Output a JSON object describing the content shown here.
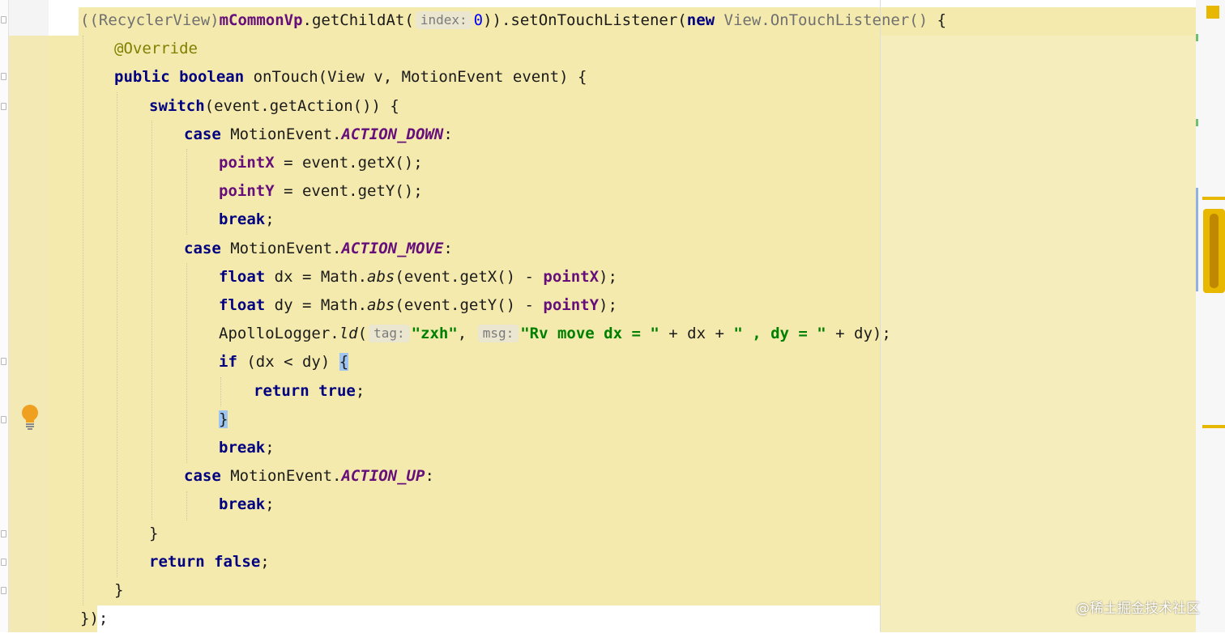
{
  "editor": {
    "colors": {
      "line_highlight": "#f4eaad",
      "keyword": "#000080",
      "field": "#660e7a",
      "string": "#008000",
      "annotation": "#808000",
      "number": "#0000ff",
      "brace_match": "#9fc6f2"
    },
    "lines": [
      {
        "tokens": [
          {
            "t": "((RecyclerView)",
            "c": "gr"
          },
          {
            "t": "mCommonVp",
            "c": "fld"
          },
          {
            "t": ".getChildAt(",
            "c": ""
          },
          {
            "t": "index:",
            "c": "hint"
          },
          {
            "t": "0",
            "c": "num"
          },
          {
            "t": ")).setOnTouchListener(",
            "c": ""
          },
          {
            "t": "new",
            "c": "kw"
          },
          {
            "t": " View.OnTouchListener()",
            "c": "gr"
          },
          {
            "t": " {",
            "c": ""
          }
        ]
      },
      {
        "tokens": [
          {
            "t": "@Override",
            "c": "ann"
          }
        ]
      },
      {
        "tokens": [
          {
            "t": "public boolean",
            "c": "kw"
          },
          {
            "t": " onTouch(View v, MotionEvent event) {",
            "c": ""
          }
        ]
      },
      {
        "tokens": [
          {
            "t": "switch",
            "c": "kw"
          },
          {
            "t": "(event.getAction()) {",
            "c": ""
          }
        ]
      },
      {
        "tokens": [
          {
            "t": "case",
            "c": "kw"
          },
          {
            "t": " MotionEvent.",
            "c": ""
          },
          {
            "t": "ACTION_DOWN",
            "c": "cst"
          },
          {
            "t": ":",
            "c": ""
          }
        ]
      },
      {
        "tokens": [
          {
            "t": "pointX",
            "c": "fld"
          },
          {
            "t": " = event.getX();",
            "c": ""
          }
        ]
      },
      {
        "tokens": [
          {
            "t": "pointY",
            "c": "fld"
          },
          {
            "t": " = event.getY();",
            "c": ""
          }
        ]
      },
      {
        "tokens": [
          {
            "t": "break",
            "c": "kw"
          },
          {
            "t": ";",
            "c": ""
          }
        ]
      },
      {
        "tokens": [
          {
            "t": "case",
            "c": "kw"
          },
          {
            "t": " MotionEvent.",
            "c": ""
          },
          {
            "t": "ACTION_MOVE",
            "c": "cst"
          },
          {
            "t": ":",
            "c": ""
          }
        ]
      },
      {
        "tokens": [
          {
            "t": "float",
            "c": "kw"
          },
          {
            "t": " dx = Math.",
            "c": ""
          },
          {
            "t": "abs",
            "c": "it"
          },
          {
            "t": "(event.getX() - ",
            "c": ""
          },
          {
            "t": "pointX",
            "c": "fld"
          },
          {
            "t": ");",
            "c": ""
          }
        ]
      },
      {
        "tokens": [
          {
            "t": "float",
            "c": "kw"
          },
          {
            "t": " dy = Math.",
            "c": ""
          },
          {
            "t": "abs",
            "c": "it"
          },
          {
            "t": "(event.getY() - ",
            "c": ""
          },
          {
            "t": "pointY",
            "c": "fld"
          },
          {
            "t": ");",
            "c": ""
          }
        ]
      },
      {
        "tokens": [
          {
            "t": "ApolloLogger.",
            "c": ""
          },
          {
            "t": "ld",
            "c": "it"
          },
          {
            "t": "(",
            "c": ""
          },
          {
            "t": "tag:",
            "c": "hint"
          },
          {
            "t": "\"zxh\"",
            "c": "str"
          },
          {
            "t": ", ",
            "c": ""
          },
          {
            "t": "msg:",
            "c": "hint"
          },
          {
            "t": "\"Rv move dx = \"",
            "c": "str"
          },
          {
            "t": " + dx + ",
            "c": ""
          },
          {
            "t": "\" , dy = \"",
            "c": "str"
          },
          {
            "t": " + dy);",
            "c": ""
          }
        ]
      },
      {
        "tokens": [
          {
            "t": "if",
            "c": "kw"
          },
          {
            "t": " (dx < dy) ",
            "c": ""
          },
          {
            "t": "{",
            "c": "brace-hl"
          }
        ]
      },
      {
        "tokens": [
          {
            "t": "return true",
            "c": "kw"
          },
          {
            "t": ";",
            "c": ""
          }
        ]
      },
      {
        "tokens": [
          {
            "t": "}",
            "c": "brace-hl"
          }
        ]
      },
      {
        "tokens": [
          {
            "t": "break",
            "c": "kw"
          },
          {
            "t": ";",
            "c": ""
          }
        ]
      },
      {
        "tokens": [
          {
            "t": "case",
            "c": "kw"
          },
          {
            "t": " MotionEvent.",
            "c": ""
          },
          {
            "t": "ACTION_UP",
            "c": "cst"
          },
          {
            "t": ":",
            "c": ""
          }
        ]
      },
      {
        "tokens": [
          {
            "t": "break",
            "c": "kw"
          },
          {
            "t": ";",
            "c": ""
          }
        ]
      },
      {
        "tokens": [
          {
            "t": "}",
            "c": ""
          }
        ]
      },
      {
        "tokens": [
          {
            "t": "return false",
            "c": "kw"
          },
          {
            "t": ";",
            "c": ""
          }
        ]
      },
      {
        "tokens": [
          {
            "t": "}",
            "c": ""
          }
        ]
      },
      {
        "tokens": [
          {
            "t": "});",
            "c": ""
          }
        ]
      }
    ]
  },
  "gutter": {
    "intention_icon": "lightbulb-icon"
  },
  "watermark": {
    "text": "@稀土掘金技术社区"
  }
}
